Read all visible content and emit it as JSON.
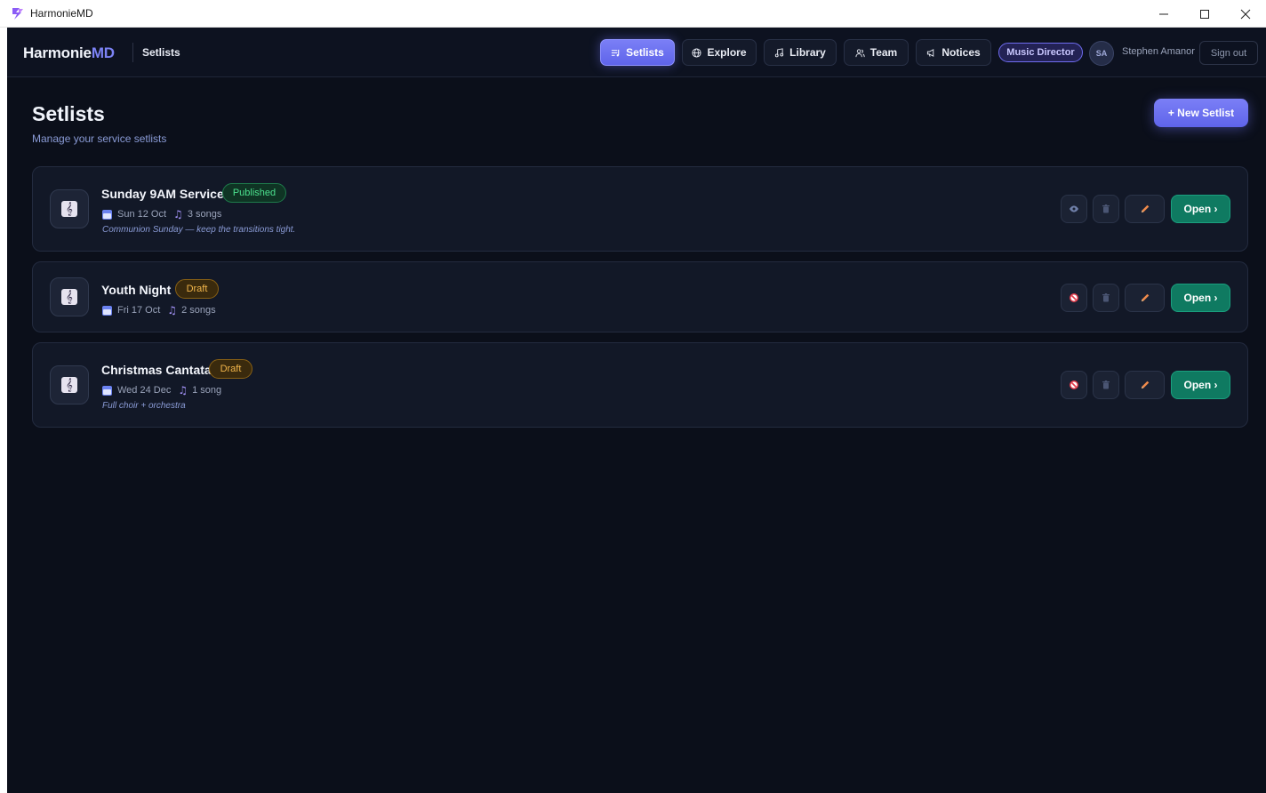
{
  "window": {
    "title": "HarmonieMD"
  },
  "brand": {
    "prefix": "Harmonie",
    "suffix": "MD",
    "section": "Setlists"
  },
  "nav": {
    "items": [
      {
        "label": "Setlists",
        "icon": "setlist-icon",
        "active": true
      },
      {
        "label": "Explore",
        "icon": "globe-icon",
        "active": false
      },
      {
        "label": "Library",
        "icon": "music-note-icon",
        "active": false
      },
      {
        "label": "Team",
        "icon": "users-icon",
        "active": false
      },
      {
        "label": "Notices",
        "icon": "megaphone-icon",
        "active": false
      }
    ],
    "role": "Music Director",
    "avatar_initials": "SA",
    "user_name": "Stephen Amanor",
    "signout": "Sign out"
  },
  "page": {
    "title": "Setlists",
    "subtitle": "Manage your service setlists",
    "new_button": "+ New Setlist"
  },
  "setlists": [
    {
      "title": "Sunday 9AM Service",
      "status": "Published",
      "date": "Sun 12 Oct",
      "songs": "3 songs",
      "note": "Communion Sunday — keep the transitions tight.",
      "visibility_icon": "eye-icon",
      "open": "Open ›"
    },
    {
      "title": "Youth Night",
      "status": "Draft",
      "date": "Fri 17 Oct",
      "songs": "2 songs",
      "note": "",
      "visibility_icon": "no-entry-icon",
      "open": "Open ›"
    },
    {
      "title": "Christmas Cantata",
      "status": "Draft",
      "date": "Wed 24 Dec",
      "songs": "1 song",
      "note": "Full choir + orchestra",
      "visibility_icon": "no-entry-icon",
      "open": "Open ›"
    }
  ],
  "colors": {
    "accent": "#6b70f0",
    "published": "#4ce08e",
    "draft": "#f2b64b",
    "open_button": "#0f7a61",
    "background": "#0b0f1a"
  }
}
